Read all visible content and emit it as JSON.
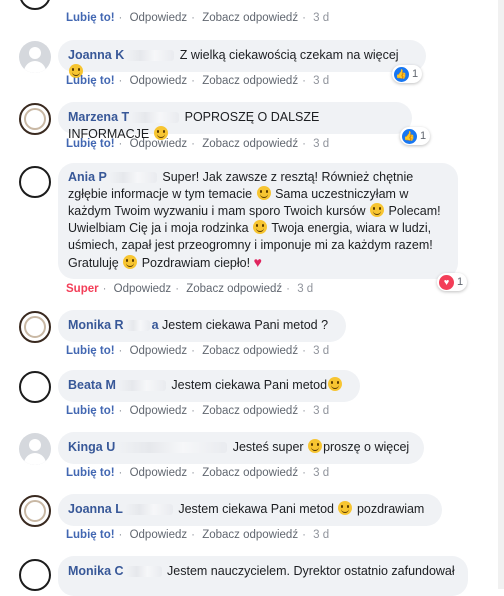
{
  "top_actions": {
    "like": "Lubię to!",
    "reply": "Odpowiedz",
    "see_reply": "Zobacz odpowiedź",
    "time": "3 d"
  },
  "comments": [
    {
      "author_visible": "Joanna K",
      "text": " Z wielką ciekawością czekam na więcej",
      "like": "Lubię to!",
      "reply": "Odpowiedz",
      "see_reply": "Zobacz odpowiedź",
      "time": "3 d",
      "reaction_count": "1"
    },
    {
      "author_visible": "Marzena T",
      "text": " POPROSZĘ O DALSZE INFORMACJE",
      "like": "Lubię to!",
      "reply": "Odpowiedz",
      "see_reply": "Zobacz odpowiedź",
      "time": "3 d",
      "reaction_count": "1"
    },
    {
      "author_visible": "Ania P",
      "lines": [
        " Super! Jak zawsze z resztą! Również chętnie",
        "zgłębie informacje w tym temacie",
        " Sama uczestniczyłam w",
        "każdym Twoim wyzwaniu i mam sporo Twoich kursów",
        " Polecam!",
        "Uwielbiam Cię ja i moja rodzinka",
        " Twoja energia, wiara w ludzi,",
        "uśmiech, zapał jest przeogromny i imponuje mi za każdym razem!",
        "Gratuluję",
        " Pozdrawiam ciepło!"
      ],
      "like": "Super",
      "reply": "Odpowiedz",
      "see_reply": "Zobacz odpowiedź",
      "time": "3 d",
      "reaction_count": "1"
    },
    {
      "author_visible": "Monika R",
      "author_tail": "a",
      "text": " Jestem ciekawa Pani metod ?",
      "like": "Lubię to!",
      "reply": "Odpowiedz",
      "see_reply": "Zobacz odpowiedź",
      "time": "3 d"
    },
    {
      "author_visible": "Beata M",
      "text": " Jestem ciekawa Pani metod",
      "like": "Lubię to!",
      "reply": "Odpowiedz",
      "see_reply": "Zobacz odpowiedź",
      "time": "3 d"
    },
    {
      "author_visible": "Kinga U",
      "text": " Jesteś super",
      "text2": "proszę o więcej",
      "like": "Lubię to!",
      "reply": "Odpowiedz",
      "see_reply": "Zobacz odpowiedź",
      "time": "3 d"
    },
    {
      "author_visible": "Joanna L",
      "text": " Jestem ciekawa Pani metod",
      "text2": " pozdrawiam",
      "like": "Lubię to!",
      "reply": "Odpowiedz",
      "see_reply": "Zobacz odpowiedź",
      "time": "3 d"
    },
    {
      "author_visible": "Monika C",
      "text": " Jestem nauczycielem. Dyrektor ostatnio zafundował"
    }
  ],
  "icons": {
    "like": "thumbs-up-icon",
    "love": "heart-icon",
    "smile": "smile-emoji-icon"
  },
  "colors": {
    "link": "#385898",
    "bubble": "#f0f2f5",
    "super": "#f33e58",
    "like_blue": "#1877f2"
  }
}
